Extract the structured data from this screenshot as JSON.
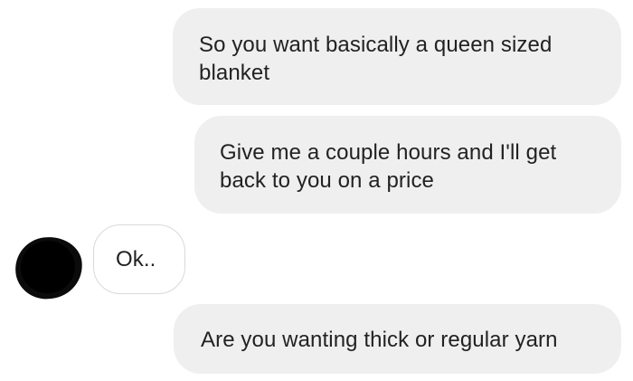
{
  "messages": [
    {
      "direction": "outgoing",
      "text": "So you want basically a queen sized blanket"
    },
    {
      "direction": "outgoing",
      "text": "Give me a couple hours and I'll get back to you on a price"
    },
    {
      "direction": "incoming",
      "text": "Ok.."
    },
    {
      "direction": "outgoing",
      "text": "Are you wanting thick or regular yarn"
    }
  ],
  "contact": {
    "avatar": "redacted-avatar"
  },
  "colors": {
    "outgoing_bubble": "#efefef",
    "incoming_bubble_border": "#d9d9d9",
    "text": "#222222",
    "avatar": "#0b0b0b"
  }
}
